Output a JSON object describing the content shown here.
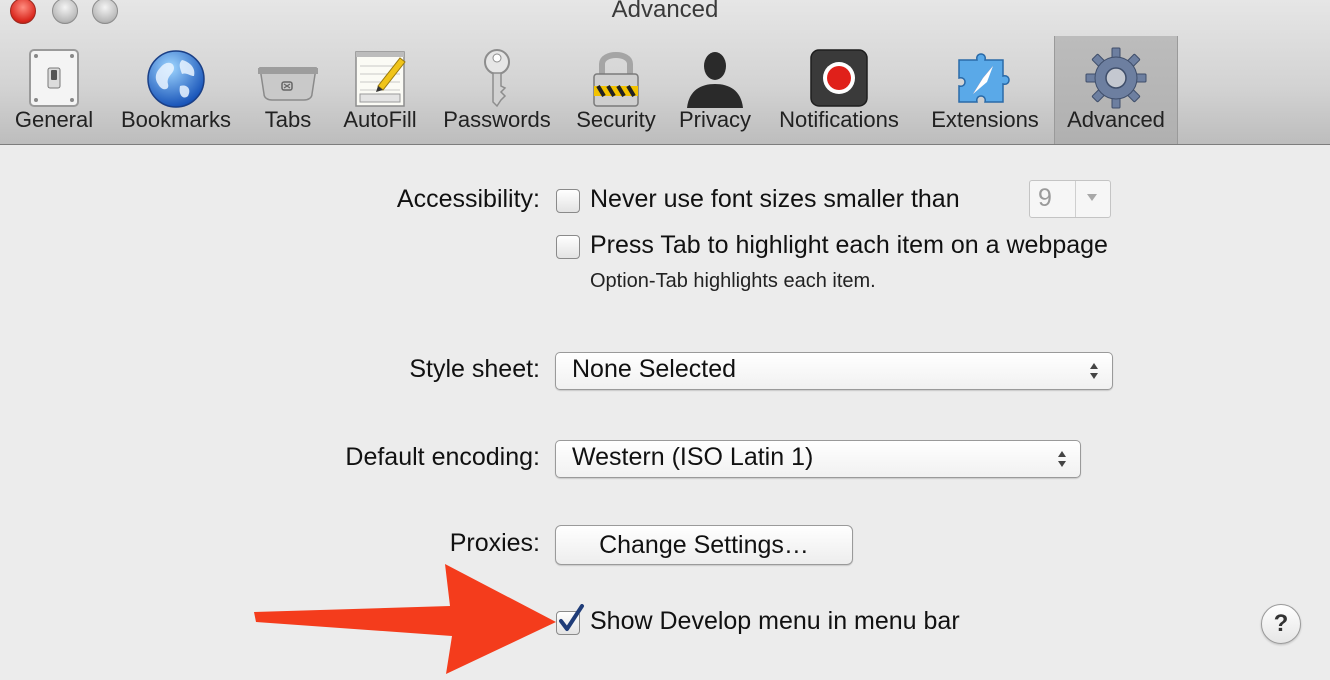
{
  "window": {
    "title": "Advanced"
  },
  "toolbar": {
    "tabs": [
      {
        "label": "General",
        "icon": "light-switch-icon"
      },
      {
        "label": "Bookmarks",
        "icon": "globe-icon"
      },
      {
        "label": "Tabs",
        "icon": "tabs-icon"
      },
      {
        "label": "AutoFill",
        "icon": "notepad-pencil-icon"
      },
      {
        "label": "Passwords",
        "icon": "key-icon"
      },
      {
        "label": "Security",
        "icon": "padlock-icon"
      },
      {
        "label": "Privacy",
        "icon": "person-silhouette-icon"
      },
      {
        "label": "Notifications",
        "icon": "record-icon"
      },
      {
        "label": "Extensions",
        "icon": "puzzle-compass-icon"
      },
      {
        "label": "Advanced",
        "icon": "gear-icon"
      }
    ],
    "selected": "Advanced"
  },
  "accessibility": {
    "label": "Accessibility:",
    "min_font_text": "Never use font sizes smaller than",
    "min_font_checked": false,
    "min_font_value": "9",
    "tab_highlight_text": "Press Tab to highlight each item on a webpage",
    "tab_highlight_checked": false,
    "tab_hint": "Option-Tab highlights each item."
  },
  "style_sheet": {
    "label": "Style sheet:",
    "value": "None Selected"
  },
  "encoding": {
    "label": "Default encoding:",
    "value": "Western (ISO Latin 1)"
  },
  "proxies": {
    "label": "Proxies:",
    "button": "Change Settings…"
  },
  "develop_menu": {
    "text": "Show Develop menu in menu bar",
    "checked": true
  },
  "help": {
    "label": "?"
  },
  "colors": {
    "annotation_arrow": "#f43c1c",
    "check_mark": "#1f3c78"
  }
}
